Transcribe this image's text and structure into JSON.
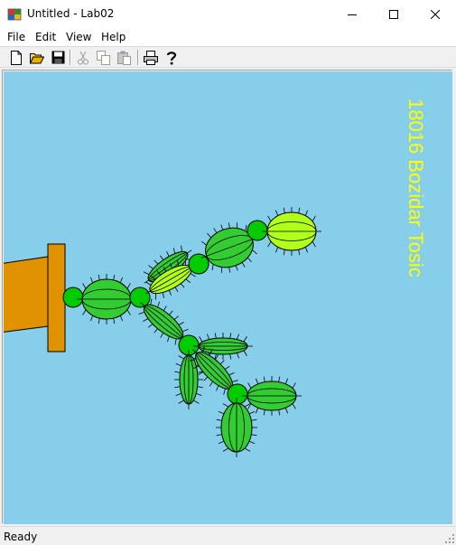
{
  "window": {
    "title": "Untitled - Lab02",
    "controls": [
      "minimize",
      "maximize",
      "close"
    ]
  },
  "menu": {
    "items": [
      {
        "label": "File"
      },
      {
        "label": "Edit"
      },
      {
        "label": "View"
      },
      {
        "label": "Help"
      }
    ]
  },
  "toolbar": {
    "buttons": [
      {
        "icon": "new-document-icon",
        "enabled": true
      },
      {
        "icon": "open-folder-icon",
        "enabled": true
      },
      {
        "icon": "save-icon",
        "enabled": true
      },
      {
        "icon": "cut-icon",
        "enabled": false
      },
      {
        "icon": "copy-icon",
        "enabled": false
      },
      {
        "icon": "paste-icon",
        "enabled": false
      },
      {
        "icon": "print-icon",
        "enabled": true
      },
      {
        "icon": "help-icon",
        "enabled": true
      }
    ]
  },
  "canvas": {
    "background": "#87ceeb",
    "author_text": "18016 Bozidar Tosic",
    "author_text_color": "#ffff00",
    "pot_color": "#e09200",
    "cactus_dark": "#33cc33",
    "cactus_light": "#b2ff1a",
    "joint_color": "#00cc00"
  },
  "status": {
    "text": "Ready"
  }
}
